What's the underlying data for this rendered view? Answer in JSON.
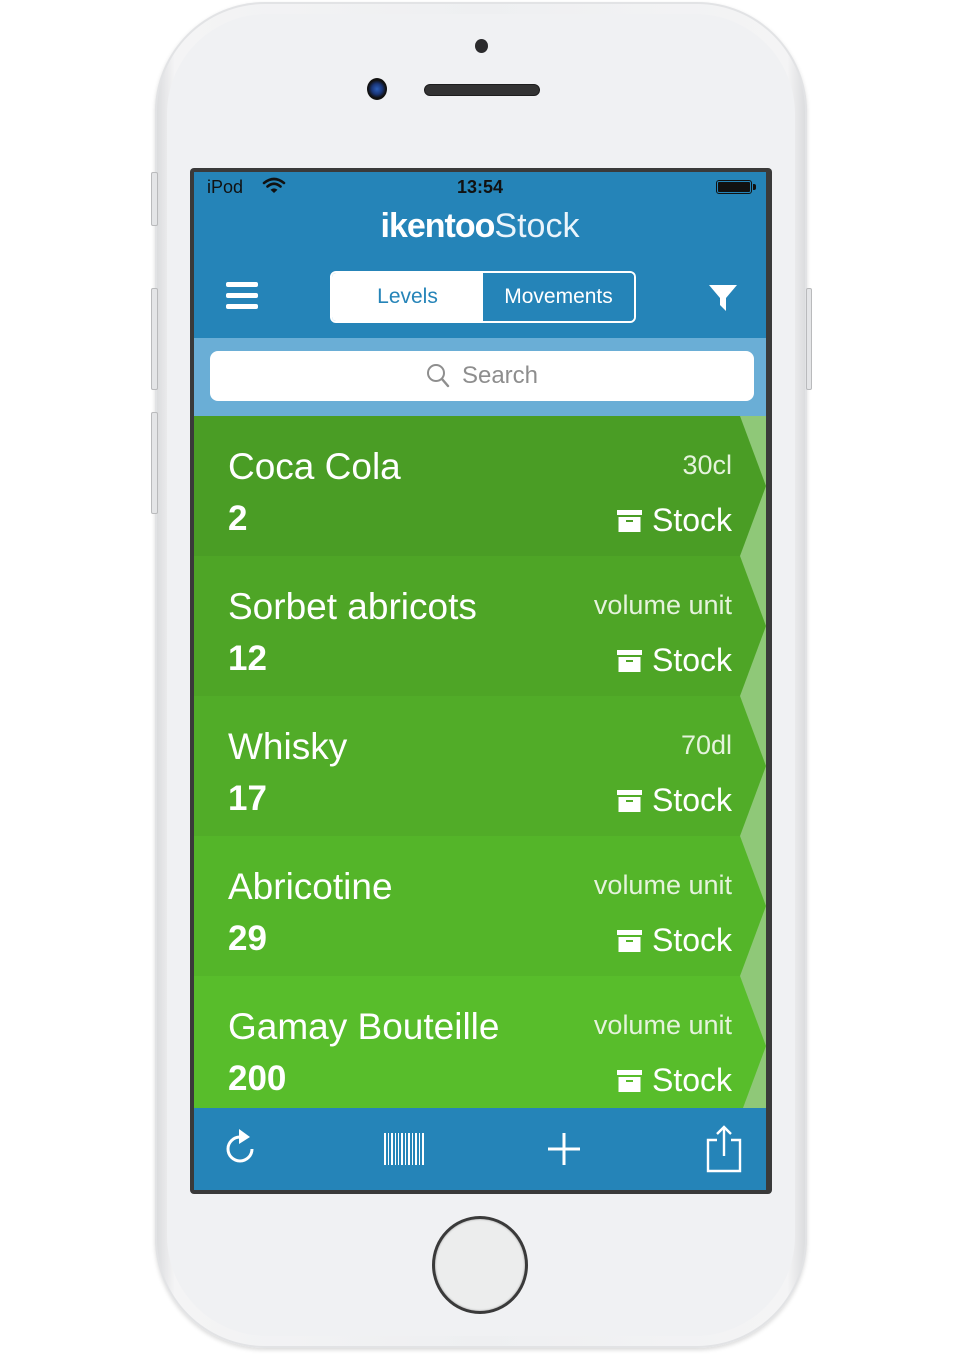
{
  "status_bar": {
    "carrier": "iPod",
    "time": "13:54",
    "wifi_icon": "wifi-icon",
    "battery_icon": "battery-full-icon"
  },
  "header": {
    "brand": "ikentoo",
    "product": "Stock",
    "menu_icon": "hamburger-menu-icon",
    "filter_icon": "filter-funnel-icon",
    "tabs": [
      {
        "label": "Levels",
        "selected": true
      },
      {
        "label": "Movements",
        "selected": false
      }
    ]
  },
  "search": {
    "placeholder": "Search",
    "icon": "search-icon"
  },
  "items": [
    {
      "name": "Coca Cola",
      "quantity": "2",
      "unit": "30cl",
      "location": "Stock",
      "color": "#4a9d25"
    },
    {
      "name": "Sorbet abricots",
      "quantity": "12",
      "unit": "volume unit",
      "location": "Stock",
      "color": "#4ea526"
    },
    {
      "name": "Whisky",
      "quantity": "17",
      "unit": "70dl",
      "location": "Stock",
      "color": "#51ac28"
    },
    {
      "name": "Abricotine",
      "quantity": "29",
      "unit": "volume unit",
      "location": "Stock",
      "color": "#54b529"
    },
    {
      "name": "Gamay Bouteille",
      "quantity": "200",
      "unit": "volume unit",
      "location": "Stock",
      "color": "#58bd2b"
    }
  ],
  "toolbar": {
    "buttons": [
      {
        "name": "refresh",
        "icon": "refresh-icon"
      },
      {
        "name": "scan-barcode",
        "icon": "barcode-icon"
      },
      {
        "name": "add",
        "icon": "plus-icon"
      },
      {
        "name": "share",
        "icon": "share-icon"
      }
    ]
  },
  "colors": {
    "header_blue": "#2584b8",
    "search_band": "#6aaed6",
    "chevron_light_green": "#8fc878"
  }
}
